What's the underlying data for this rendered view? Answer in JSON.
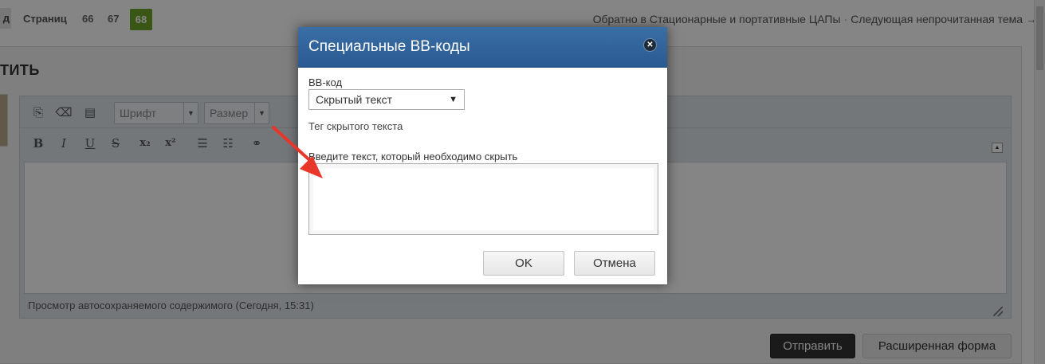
{
  "nav": {
    "partial_label": "д",
    "pages_label": "Страниц",
    "pages": [
      "66",
      "67"
    ],
    "current_page": "68",
    "back_link": "Обратно в Стационарные и портативные ЦАПы",
    "separator": "·",
    "next_link": "Следующая непрочитанная тема →"
  },
  "reply": {
    "title_partial": "ТИТЬ"
  },
  "editor": {
    "toolbar_row1": [
      {
        "name": "source-mode-icon",
        "glyph": "⎘"
      },
      {
        "name": "eraser-icon",
        "glyph": "⌫"
      },
      {
        "name": "template-icon",
        "glyph": "▤"
      }
    ],
    "font_select": "Шрифт",
    "size_select": "Размер",
    "toolbar_row2": [
      {
        "name": "bold-icon",
        "glyph": "B"
      },
      {
        "name": "italic-icon",
        "glyph": "I"
      },
      {
        "name": "underline-icon",
        "glyph": "U"
      },
      {
        "name": "strikethrough-icon",
        "glyph": "S"
      },
      {
        "name": "subscript-icon",
        "glyph": "x₂"
      },
      {
        "name": "superscript-icon",
        "glyph": "x²"
      },
      {
        "name": "bullet-list-icon",
        "glyph": "☰"
      },
      {
        "name": "numbered-list-icon",
        "glyph": "☷"
      },
      {
        "name": "link-icon",
        "glyph": "⚭"
      }
    ],
    "autosave_text": "Просмотр автосохраняемого содержимого (Сегодня, 15:31)"
  },
  "actions": {
    "send_label": "Отправить",
    "advanced_label": "Расширенная форма"
  },
  "dialog": {
    "title": "Специальные BB-коды",
    "bbcode_label": "BB-код",
    "bbcode_selected": "Скрытый текст",
    "description": "Тег скрытого текста",
    "text_label": "Введите текст, который необходимо скрыть",
    "text_value": "",
    "ok_label": "OK",
    "cancel_label": "Отмена"
  },
  "colors": {
    "header_blue": "#2f639c",
    "page_current": "#6da52a",
    "annotation_arrow": "#e8362a"
  }
}
